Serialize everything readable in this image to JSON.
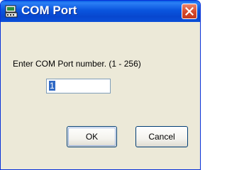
{
  "window": {
    "title": "COM Port",
    "title_icon": "serial-port-icon",
    "close_icon": "close-icon"
  },
  "dialog": {
    "prompt": "Enter COM Port number. (1 - 256)",
    "port_value": "1",
    "ok_label": "OK",
    "cancel_label": "Cancel"
  },
  "colors": {
    "titlebar": "#0a55de",
    "close_button": "#d6482a",
    "dialog_background": "#ece9d8",
    "input_border": "#7f9db9",
    "selection": "#316ac5"
  }
}
